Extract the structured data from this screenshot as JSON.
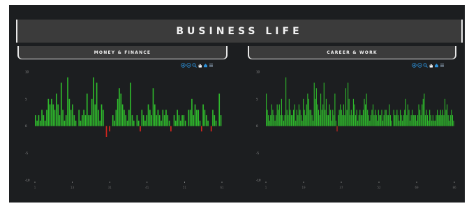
{
  "banner": {
    "title": "BUSINESS LIFE"
  },
  "tabs": [
    {
      "label": "MONEY & FINANCE"
    },
    {
      "label": "CAREER & WORK"
    }
  ],
  "toolbar_icons": [
    "zoom-in-icon",
    "zoom-out-icon",
    "magnify-icon",
    "pan-icon",
    "home-icon",
    "menu-icon"
  ],
  "colors": {
    "positive": "#2fb92c",
    "negative": "#d7261e",
    "background": "#1c1e20",
    "toolbar": "#2b8fd6"
  },
  "chart_data": [
    {
      "type": "bar",
      "title": "MONEY & FINANCE",
      "ylim": [
        -10,
        10
      ],
      "yticks": [
        10,
        5,
        0,
        -5,
        -10
      ],
      "xticks": [
        "1",
        "13",
        "31",
        "41",
        "51",
        "61"
      ],
      "grid": false,
      "values": [
        2,
        1,
        2,
        1,
        3,
        2,
        1,
        3,
        5,
        4,
        5,
        4,
        3,
        6,
        4,
        2,
        8,
        3,
        1,
        2,
        9,
        5,
        3,
        4,
        2,
        1,
        0,
        3,
        1,
        2,
        3,
        2,
        6,
        2,
        2,
        5,
        9,
        4,
        8,
        3,
        1,
        4,
        3,
        0,
        -2,
        0,
        -1,
        0,
        2,
        1,
        3,
        5,
        7,
        6,
        4,
        3,
        2,
        1,
        3,
        8,
        2,
        1,
        0,
        2,
        1,
        -1,
        3,
        2,
        1,
        2,
        4,
        3,
        2,
        7,
        4,
        2,
        3,
        2,
        1,
        3,
        2,
        3,
        2,
        1,
        -1,
        0,
        2,
        1,
        3,
        2,
        1,
        2,
        2,
        1,
        0,
        3,
        3,
        5,
        2,
        4,
        3,
        3,
        1,
        -1,
        4,
        3,
        2,
        1,
        0,
        -1,
        3,
        2,
        1,
        0,
        6,
        2
      ]
    },
    {
      "type": "bar",
      "title": "CAREER & WORK",
      "ylim": [
        -10,
        10
      ],
      "yticks": [
        10,
        5,
        0,
        -5,
        -10
      ],
      "xticks": [
        "1",
        "19",
        "37",
        "52",
        "69",
        "86"
      ],
      "grid": false,
      "values": [
        6,
        3,
        2,
        1,
        2,
        4,
        3,
        2,
        1,
        2,
        4,
        3,
        4,
        2,
        5,
        2,
        1,
        2,
        9,
        3,
        2,
        5,
        3,
        2,
        2,
        3,
        4,
        1,
        3,
        2,
        4,
        3,
        2,
        1,
        5,
        3,
        2,
        4,
        6,
        5,
        3,
        3,
        2,
        1,
        8,
        5,
        7,
        4,
        3,
        2,
        6,
        3,
        4,
        8,
        3,
        5,
        2,
        2,
        4,
        3,
        1,
        3,
        2,
        6,
        1,
        -1,
        2,
        3,
        4,
        3,
        2,
        4,
        2,
        7,
        3,
        8,
        5,
        2,
        3,
        2,
        5,
        4,
        2,
        3,
        1,
        2,
        3,
        2,
        2,
        3,
        5,
        4,
        6,
        3,
        2,
        1,
        2,
        3,
        4,
        2,
        3,
        2,
        1,
        3,
        2,
        2,
        3,
        1,
        2,
        3,
        3,
        2,
        2,
        4,
        2,
        1,
        0,
        3,
        2,
        2,
        3,
        2,
        1,
        3,
        2,
        1,
        2,
        3,
        5,
        2,
        4,
        3,
        1,
        2,
        3,
        2,
        2,
        2,
        1,
        2,
        4,
        3,
        2,
        4,
        5,
        6,
        2,
        3,
        2,
        1,
        3,
        2,
        1,
        2,
        1,
        1,
        2,
        3,
        2,
        2,
        3,
        2,
        3,
        2,
        5,
        3,
        4,
        2,
        1,
        2,
        3,
        2,
        1
      ]
    }
  ]
}
